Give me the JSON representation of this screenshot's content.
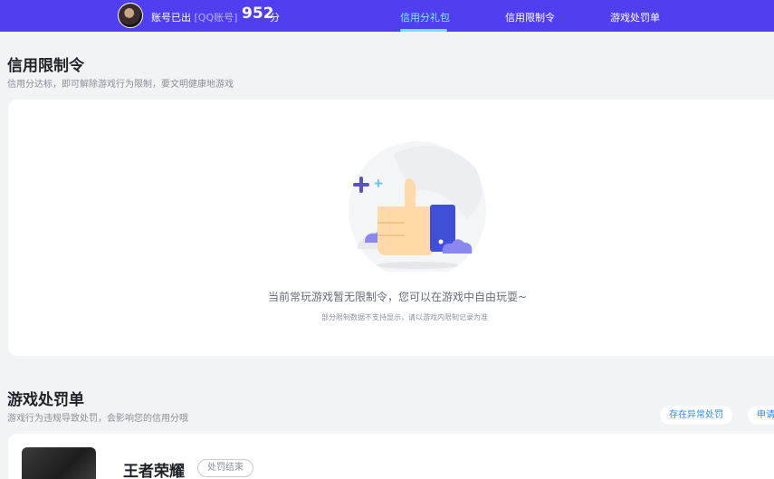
{
  "header": {
    "account_status": "账号已出",
    "account_type": "[QQ账号]",
    "score": "952",
    "score_unit": "分",
    "tabs": [
      {
        "label": "信用分礼包",
        "active": true
      },
      {
        "label": "信用限制令",
        "active": false
      },
      {
        "label": "游戏处罚单",
        "active": false
      }
    ]
  },
  "restriction": {
    "title": "信用限制令",
    "subtitle": "信用分达标，即可解除游戏行为限制，要文明健康地游戏",
    "empty_main": "当前常玩游戏暂无限制令，您可以在游戏中自由玩耍~",
    "empty_sub": "部分限制数据不支持显示，请以游戏内限制记录为准"
  },
  "penalty": {
    "title": "游戏处罚单",
    "subtitle": "游戏行为违规导致处罚，会影响您的信用分哦",
    "actions": [
      "存在异常处罚",
      "申请"
    ],
    "items": [
      {
        "game": "王者荣耀",
        "status": "处罚结束"
      }
    ]
  },
  "colors": {
    "header_bg": "#4f3ff0",
    "tab_active": "#7ff0ff",
    "link_blue": "#2d8cf0"
  }
}
